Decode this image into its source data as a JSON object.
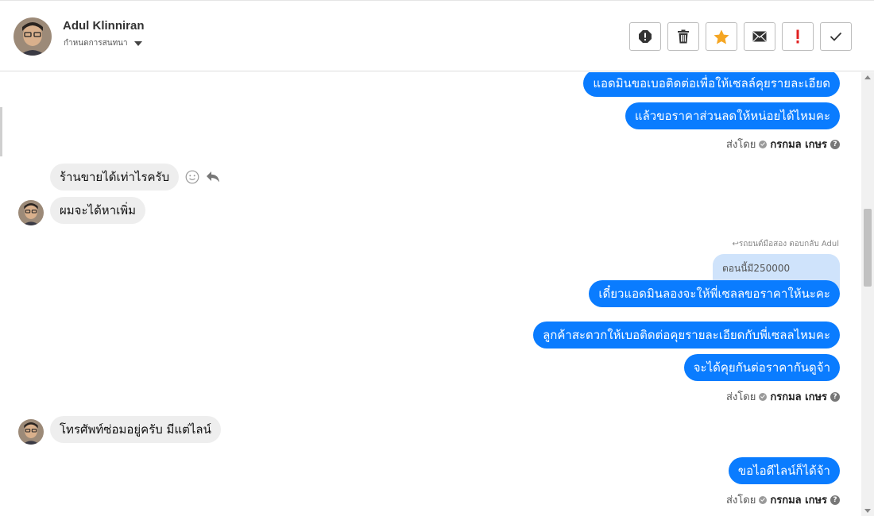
{
  "header": {
    "contact_name": "Adul Klinniran",
    "conversation_settings": "กำหนดการสนทนา"
  },
  "toolbar": {
    "buttons": [
      "spam-icon",
      "trash-icon",
      "star-icon",
      "envelope-icon",
      "exclamation-icon",
      "check-icon"
    ]
  },
  "colors": {
    "outgoing_bubble": "#0a7cff",
    "incoming_bubble": "#eeeeee",
    "quote_bubble": "#cfe3fb",
    "star": "#f5a623",
    "important": "#e02020"
  },
  "messages": {
    "m1": "แอดมินขอเบอติดต่อเพื่อให้เซลล์คุยรายละเอียด",
    "m2": "แล้วขอราคาส่วนลดให้หน่อยได้ไหมคะ",
    "m3": "ร้านขายได้เท่าไรครับ",
    "m4": "ผมจะได้หาเพิ่ม",
    "reply_hint": "รถยนต์มือสอง ตอบกลับ Adul",
    "quoted": "ตอนนี้มี250000",
    "m5": "เดี๋ยวแอดมินลองจะให้พี่เซลลขอราคาให้นะคะ",
    "m6": "ลูกค้าสะดวกให้เบอติดต่อคุยรายละเอียดกับพี่เซลลไหมคะ",
    "m7": "จะได้คุยกันต่อราคากันดูจ้า",
    "m8": "โทรศัพท์ซ่อมอยู่ครับ มีแต่ไลน์",
    "m9": "ขอไอดีไลน์ก็ได้จ้า"
  },
  "sent_by": {
    "label": "ส่งโดย",
    "name": "กรกมล เกษร"
  }
}
